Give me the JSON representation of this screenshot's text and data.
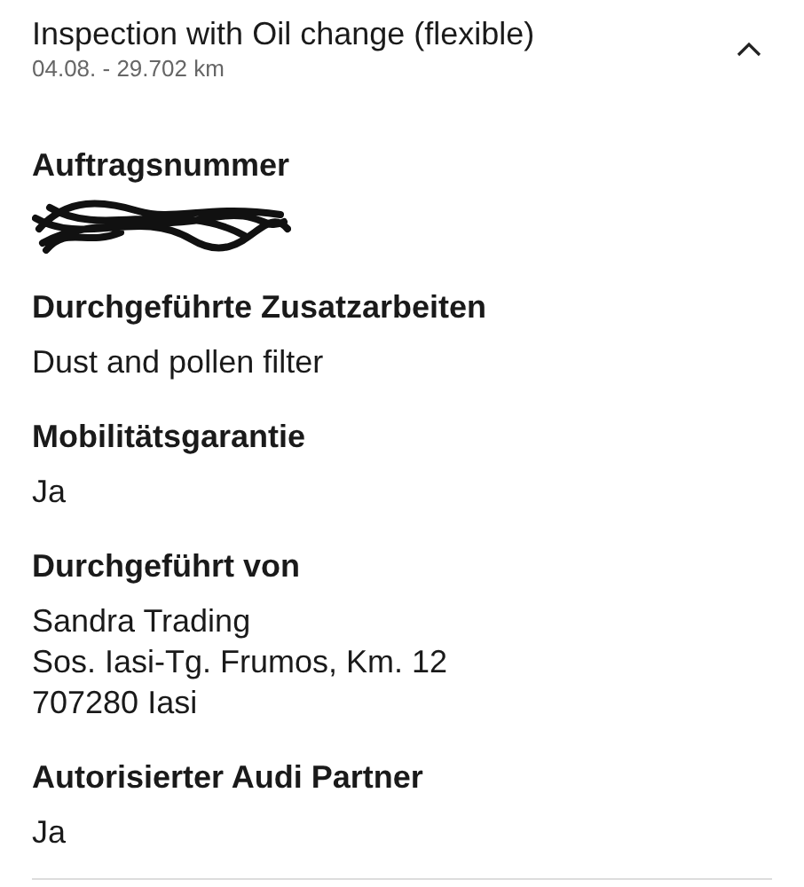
{
  "header": {
    "title": "Inspection with Oil change (flexible)",
    "subtitle": "04.08. - 29.702 km",
    "expanded": true
  },
  "sections": [
    {
      "kind": "redacted",
      "label": "Auftragsnummer"
    },
    {
      "kind": "text",
      "label": "Durchgeführte Zusatzarbeiten",
      "lines": [
        "Dust and pollen filter"
      ]
    },
    {
      "kind": "text",
      "label": "Mobilitätsgarantie",
      "lines": [
        "Ja"
      ]
    },
    {
      "kind": "text",
      "label": "Durchgeführt von",
      "lines": [
        "Sandra Trading",
        "Sos. Iasi-Tg. Frumos, Km. 12",
        "707280 Iasi"
      ]
    },
    {
      "kind": "text",
      "label": "Autorisierter Audi Partner",
      "lines": [
        "Ja"
      ]
    }
  ]
}
